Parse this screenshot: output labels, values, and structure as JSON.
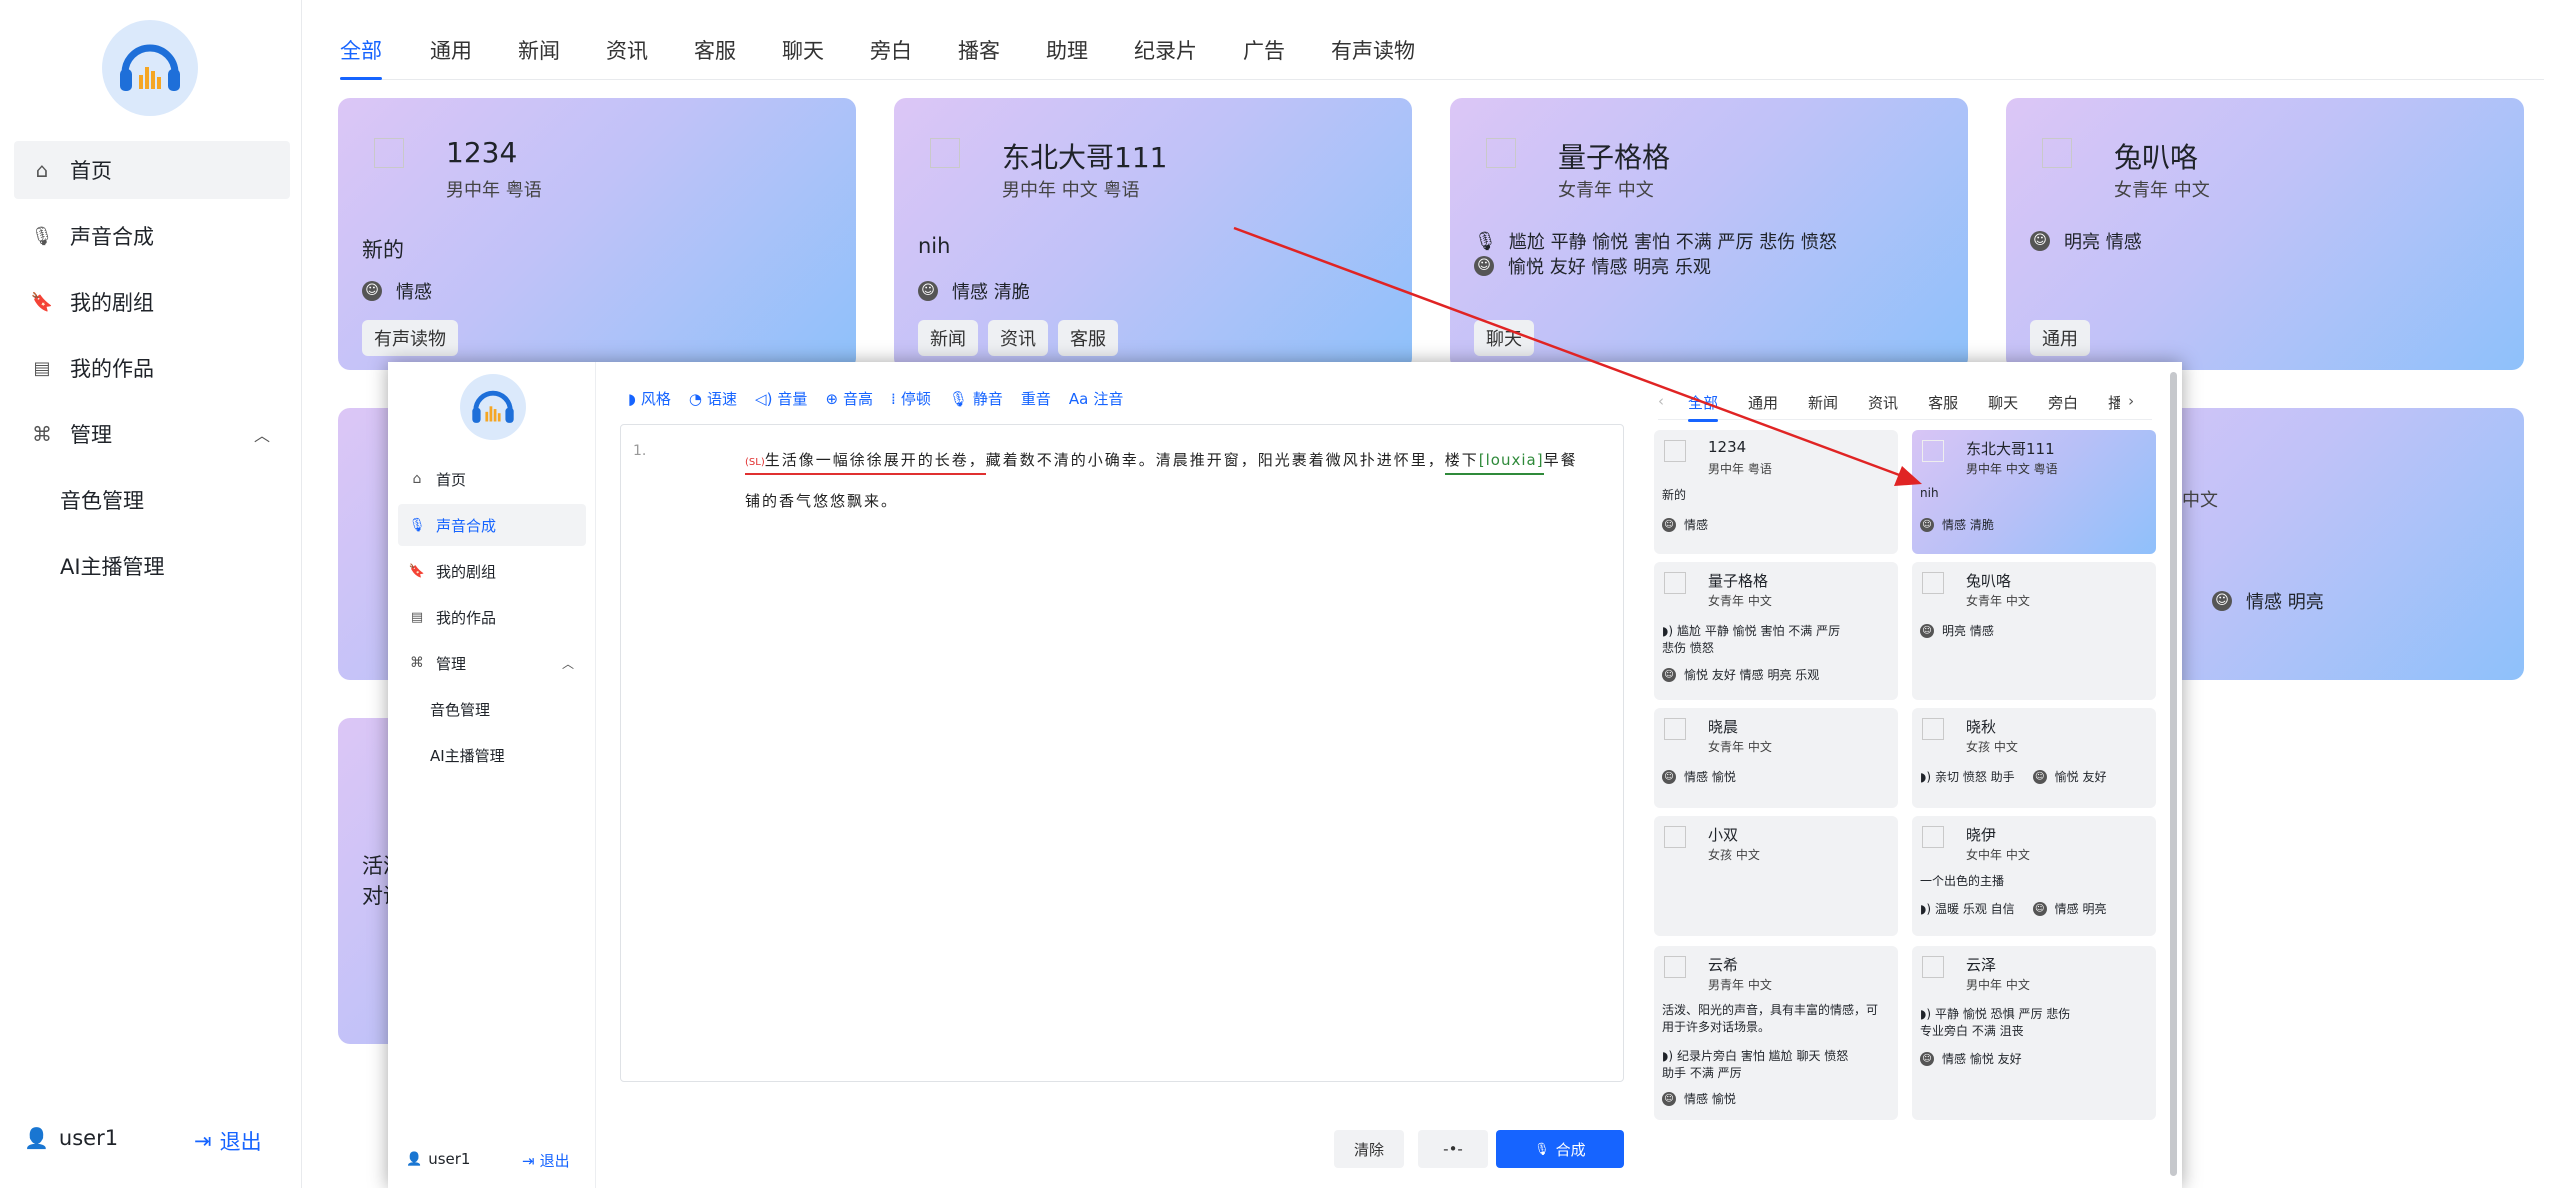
{
  "app": {
    "user": "user1",
    "logout": "退出",
    "nav": [
      {
        "label": "首页",
        "icon": "home-icon",
        "active": true
      },
      {
        "label": "声音合成",
        "icon": "mic-icon",
        "active": false
      },
      {
        "label": "我的剧组",
        "icon": "bookmark-icon",
        "active": false
      },
      {
        "label": "我的作品",
        "icon": "archive-icon",
        "active": false
      }
    ],
    "manage": {
      "label": "管理",
      "icon": "command-icon",
      "children": [
        "音色管理",
        "AI主播管理"
      ]
    }
  },
  "bg": {
    "tabs": [
      "全部",
      "通用",
      "新闻",
      "资讯",
      "客服",
      "聊天",
      "旁白",
      "播客",
      "助理",
      "纪录片",
      "广告",
      "有声读物"
    ],
    "cards": [
      {
        "name": "1234",
        "meta": "男中年 粤语",
        "desc": "新的",
        "emotions": "情感",
        "tags": [
          "有声读物"
        ]
      },
      {
        "name": "东北大哥111",
        "meta": "男中年 中文 粤语",
        "desc": "nih",
        "emotions": "情感 清脆",
        "tags": [
          "新闻",
          "资讯",
          "客服"
        ]
      },
      {
        "name": "量子格格",
        "meta": "女青年 中文",
        "styles": "尴尬 平静 愉悦 害怕 不满 严厉 悲伤 愤怒",
        "emotions": "愉悦 友好 情感 明亮 乐观",
        "tags": [
          "聊天"
        ]
      },
      {
        "name": "兔叭咯",
        "meta": "女青年 中文",
        "emotions": "明亮 情感",
        "tags": [
          "通用"
        ]
      }
    ],
    "row2_right": {
      "meta": "中文",
      "emotions": "情感 明亮"
    },
    "row3_left": {
      "line1": "活泼",
      "line2": "对话"
    }
  },
  "fg": {
    "toolbar": [
      "风格",
      "语速",
      "音量",
      "音高",
      "停顿",
      "静音",
      "重音",
      "注音"
    ],
    "toolbar_icons": [
      "style-icon",
      "speed-icon",
      "volume-icon",
      "pitch-icon",
      "pause-icon",
      "mute-icon",
      "stress-icon",
      "phonetic-icon"
    ],
    "editor": {
      "line_no": "1.",
      "tag": "(SL)",
      "seg1": "生活像一幅徐徐展开的长卷，",
      "seg2": "藏着数不清的小确幸。清晨推开窗，阳光裹着微风扑进怀里，",
      "seg3": "楼下",
      "seg4": "[louxia]",
      "seg5": "早餐",
      "line2": "铺的香气悠悠飘来。"
    },
    "buttons": {
      "clear": "清除",
      "synth": "合成"
    },
    "tabs": [
      "全部",
      "通用",
      "新闻",
      "资讯",
      "客服",
      "聊天",
      "旁白",
      "播"
    ],
    "cards": [
      {
        "name": "1234",
        "meta": "男中年 粤语",
        "desc": "新的",
        "emotions": "情感"
      },
      {
        "name": "东北大哥111",
        "meta": "男中年 中文 粤语",
        "desc": "nih",
        "emotions": "情感 清脆"
      },
      {
        "name": "量子格格",
        "meta": "女青年 中文",
        "styles": "尴尬 平静 愉悦 害怕 不满 严厉",
        "styles2": "悲伤 愤怒",
        "emotions": "愉悦 友好 情感 明亮 乐观"
      },
      {
        "name": "兔叭咯",
        "meta": "女青年 中文",
        "emotions": "明亮 情感"
      },
      {
        "name": "晓晨",
        "meta": "女青年 中文",
        "emotions": "情感 愉悦"
      },
      {
        "name": "晓秋",
        "meta": "女孩 中文",
        "styles": "亲切 愤怒 助手",
        "emotions": "愉悦 友好"
      },
      {
        "name": "小双",
        "meta": "女孩 中文"
      },
      {
        "name": "晓伊",
        "meta": "女中年 中文",
        "desc": "一个出色的主播",
        "styles": "温暖 乐观 自信",
        "emotions": "情感 明亮"
      },
      {
        "name": "云希",
        "meta": "男青年 中文",
        "desc": "活泼、阳光的声音，具有丰富的情感，可",
        "desc2": "用于许多对话场景。",
        "styles": "纪录片旁白 害怕 尴尬 聊天 愤怒",
        "styles2": "助手 不满 严厉",
        "emotions": "情感 愉悦"
      },
      {
        "name": "云泽",
        "meta": "男中年 中文",
        "styles": "平静 愉悦 恐惧 严厉 悲伤",
        "styles2": "专业旁白 不满 沮丧",
        "emotions": "情感 愉悦 友好"
      }
    ]
  },
  "colors": {
    "accent": "#1664ff",
    "annotation": "#e03030",
    "arrow": "#e02424"
  }
}
